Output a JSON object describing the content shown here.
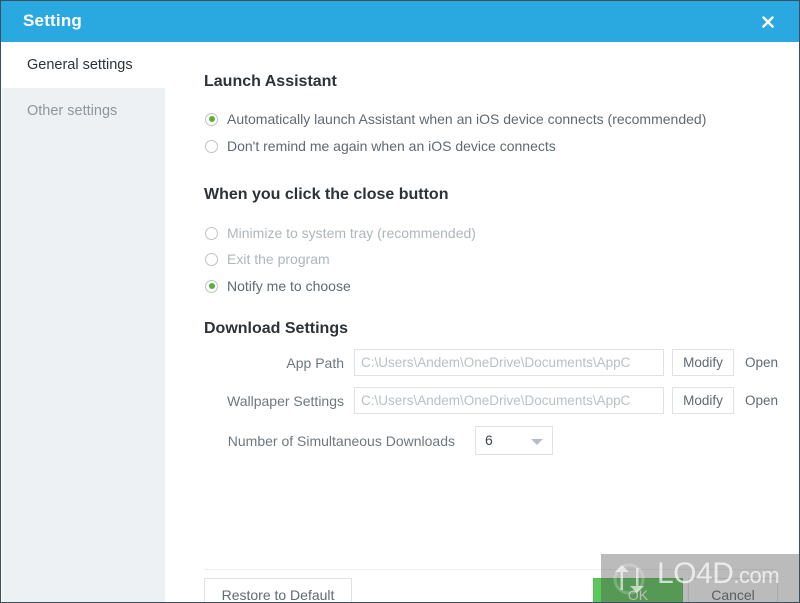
{
  "window": {
    "title": "Setting",
    "close_icon": "close-icon",
    "accent_color": "#2aa9e0"
  },
  "sidebar": {
    "items": [
      {
        "label": "General settings",
        "active": true
      },
      {
        "label": "Other settings",
        "active": false
      }
    ]
  },
  "main": {
    "launch_assistant": {
      "title": "Launch Assistant",
      "options": [
        {
          "label": "Automatically launch Assistant when an iOS device connects (recommended)",
          "selected": true
        },
        {
          "label": "Don't remind me again when an iOS device connects",
          "selected": false
        }
      ]
    },
    "close_button_behavior": {
      "title": "When you click the close button",
      "options": [
        {
          "label": "Minimize to system tray (recommended)",
          "selected": false
        },
        {
          "label": "Exit the program",
          "selected": false
        },
        {
          "label": "Notify me to choose",
          "selected": true
        }
      ]
    },
    "download_settings": {
      "title": "Download Settings",
      "app_path": {
        "label": "App Path",
        "value": "C:\\Users\\Andem\\OneDrive\\Documents\\AppC",
        "modify_label": "Modify",
        "open_label": "Open"
      },
      "wallpaper_settings": {
        "label": "Wallpaper Settings",
        "value": "C:\\Users\\Andem\\OneDrive\\Documents\\AppC",
        "modify_label": "Modify",
        "open_label": "Open"
      },
      "simultaneous_downloads": {
        "label": "Number of Simultaneous Downloads",
        "value": "6"
      }
    }
  },
  "footer": {
    "restore_label": "Restore to Default",
    "ok_label": "OK",
    "cancel_label": "Cancel",
    "ok_color": "#5bc85b"
  },
  "watermark": {
    "text": "LO4D",
    "suffix": ".com",
    "logo_icon": "refresh-arrows-icon"
  }
}
